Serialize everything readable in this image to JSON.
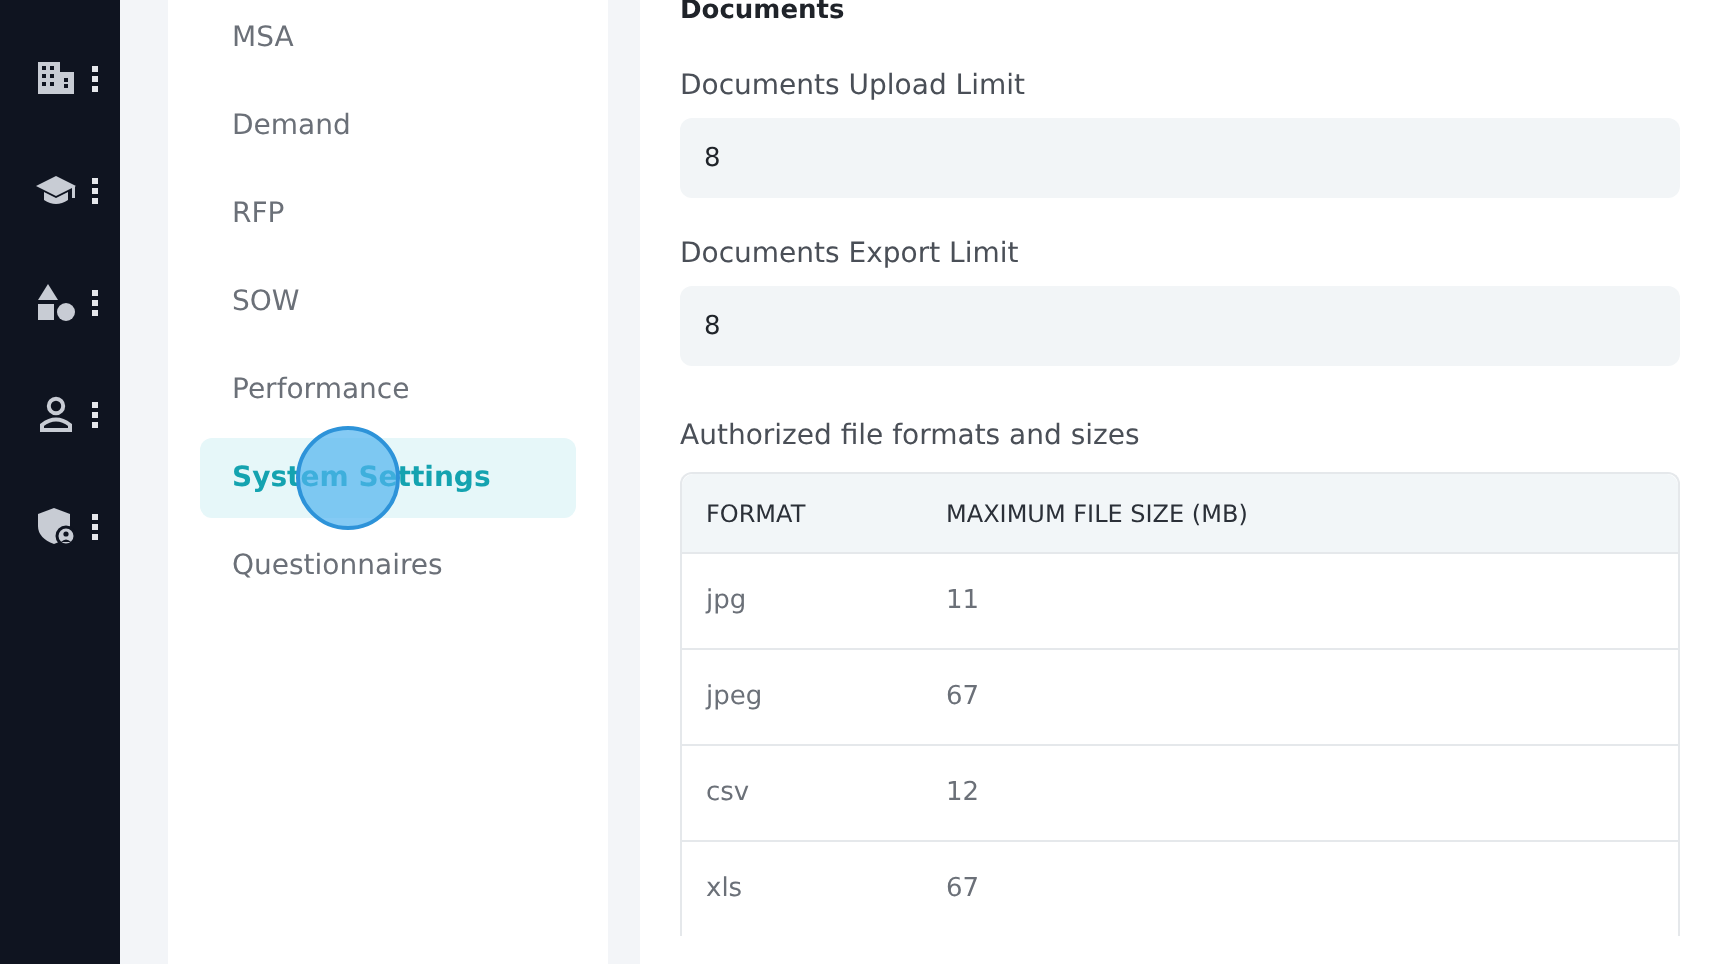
{
  "rail": {
    "items": [
      {
        "kind": "building"
      },
      {
        "kind": "cap"
      },
      {
        "kind": "shapes"
      },
      {
        "kind": "person"
      },
      {
        "kind": "shield"
      }
    ]
  },
  "nav": {
    "items": [
      {
        "label": "MSA",
        "selected": false
      },
      {
        "label": "Demand",
        "selected": false
      },
      {
        "label": "RFP",
        "selected": false
      },
      {
        "label": "SOW",
        "selected": false
      },
      {
        "label": "Performance",
        "selected": false
      },
      {
        "label": "System Settings",
        "selected": true
      },
      {
        "label": "Questionnaires",
        "selected": false
      }
    ]
  },
  "content": {
    "heading": "Documents",
    "fields": [
      {
        "label": "Documents Upload Limit",
        "value": "8"
      },
      {
        "label": "Documents Export Limit",
        "value": "8"
      }
    ],
    "table_title": "Authorized file formats and sizes",
    "table": {
      "columns": [
        "FORMAT",
        "MAXIMUM FILE SIZE (MB)"
      ],
      "rows": [
        [
          "jpg",
          "11"
        ],
        [
          "jpeg",
          "67"
        ],
        [
          "csv",
          "12"
        ],
        [
          "xls",
          "67"
        ]
      ]
    }
  }
}
